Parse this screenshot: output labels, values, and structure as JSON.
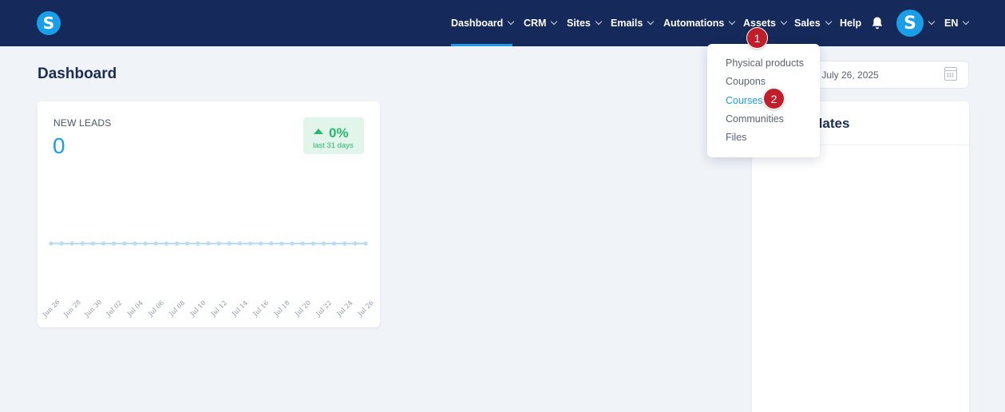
{
  "brand": {
    "logo_letter": "S"
  },
  "navbar": {
    "items": [
      {
        "label": "Dashboard",
        "has_chevron": true
      },
      {
        "label": "CRM",
        "has_chevron": true
      },
      {
        "label": "Sites",
        "has_chevron": true
      },
      {
        "label": "Emails",
        "has_chevron": true
      },
      {
        "label": "Automations",
        "has_chevron": true
      },
      {
        "label": "Assets",
        "has_chevron": true
      },
      {
        "label": "Sales",
        "has_chevron": true
      },
      {
        "label": "Help",
        "has_chevron": false
      }
    ],
    "active_item": "Dashboard",
    "notification_icon": "bell-icon",
    "avatar_letter": "S",
    "language": "EN"
  },
  "page": {
    "title": "Dashboard"
  },
  "date_range": {
    "text": "5 - July 26, 2025",
    "icon": "calendar-icon"
  },
  "new_leads": {
    "label": "NEW LEADS",
    "value": "0",
    "change": "0%",
    "change_caption": "last 31 days",
    "change_direction": "up",
    "color_positive": "#2bb673"
  },
  "chart_data": {
    "type": "line",
    "x": [
      "Jun 26",
      "Jun 27",
      "Jun 28",
      "Jun 29",
      "Jun 30",
      "Jul 01",
      "Jul 02",
      "Jul 03",
      "Jul 04",
      "Jul 05",
      "Jul 06",
      "Jul 07",
      "Jul 08",
      "Jul 09",
      "Jul 10",
      "Jul 11",
      "Jul 12",
      "Jul 13",
      "Jul 14",
      "Jul 15",
      "Jul 16",
      "Jul 17",
      "Jul 18",
      "Jul 19",
      "Jul 20",
      "Jul 21",
      "Jul 22",
      "Jul 23",
      "Jul 24",
      "Jul 25",
      "Jul 26"
    ],
    "series": [
      {
        "values": [
          0,
          0,
          0,
          0,
          0,
          0,
          0,
          0,
          0,
          0,
          0,
          0,
          0,
          0,
          0,
          0,
          0,
          0,
          0,
          0,
          0,
          0,
          0,
          0,
          0,
          0,
          0,
          0,
          0,
          0,
          0
        ]
      }
    ],
    "tick_labels": [
      "Jun 26",
      "Jun 28",
      "Jun 30",
      "Jul 02",
      "Jul 04",
      "Jul 06",
      "Jul 08",
      "Jul 10",
      "Jul 12",
      "Jul 14",
      "Jul 16",
      "Jul 18",
      "Jul 20",
      "Jul 22",
      "Jul 24",
      "Jul 26"
    ],
    "grid": false,
    "color": "#b9dcf3"
  },
  "right_panel": {
    "title": "dates"
  },
  "assets_menu": {
    "items": [
      "Physical products",
      "Coupons",
      "Courses",
      "Communities",
      "Files"
    ],
    "highlighted": "Courses"
  },
  "annotations": {
    "markers": [
      "1",
      "2"
    ]
  },
  "colors": {
    "navbar": "#15295a",
    "accent": "#1b9ee8",
    "background": "#f0f3f8",
    "marker": "#c01e2a"
  }
}
